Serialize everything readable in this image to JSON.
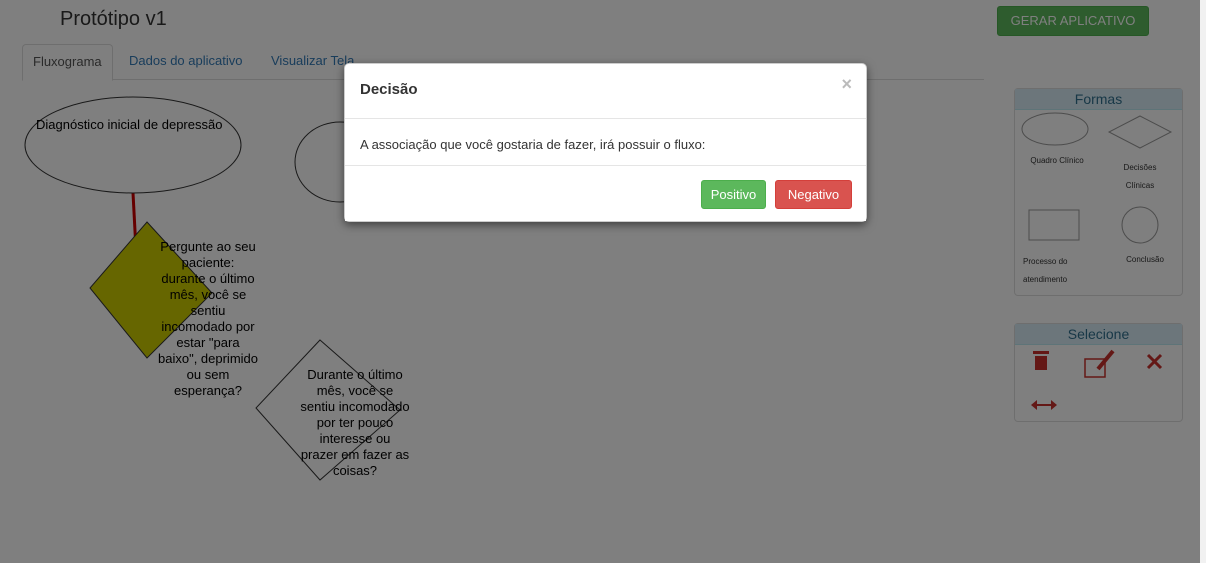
{
  "header": {
    "title": "Protótipo v1",
    "generate_button": "GERAR APLICATIVO"
  },
  "tabs": [
    {
      "label": "Fluxograma",
      "active": true
    },
    {
      "label": "Dados do aplicativo",
      "active": false
    },
    {
      "label": "Visualizar Tela",
      "active": false
    }
  ],
  "flowchart": {
    "ellipse1": "Diagnóstico inicial de depressão",
    "diamond1": "Pergunte ao seu paciente: durante o último mês, você se sentiu incomodado por estar \"para baixo\", deprimido ou sem esperança?",
    "diamond2": "Durante o último mês, você se sentiu incomodado por ter pouco interesse ou prazer em fazer as coisas?"
  },
  "shapes_panel": {
    "title": "Formas",
    "items": [
      {
        "label": "Quadro Clínico",
        "icon": "ellipse-icon"
      },
      {
        "label": "Decisões Clínicas",
        "icon": "diamond-icon"
      },
      {
        "label": "Processo do atendimento",
        "icon": "rectangle-icon"
      },
      {
        "label": "Conclusão",
        "icon": "circle-icon"
      }
    ]
  },
  "select_panel": {
    "title": "Selecione",
    "tools": [
      "trash-icon",
      "edit-icon",
      "resize-icon",
      "horizontal-arrows-icon"
    ]
  },
  "modal": {
    "title": "Decisão",
    "close": "×",
    "message": "A associação que você gostaria de fazer, irá possuir o fluxo:",
    "positive": "Positivo",
    "negative": "Negativo"
  },
  "colors": {
    "positive": "#5cb85c",
    "negative": "#d9534f",
    "link": "#337ab7",
    "diamond_fill": "#cccc00",
    "connector": "#cc0000"
  }
}
